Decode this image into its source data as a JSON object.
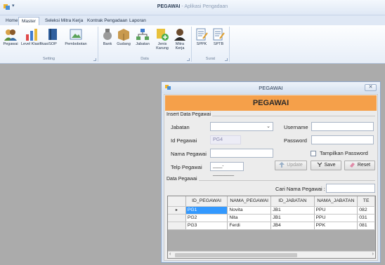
{
  "window": {
    "title_app": "PEGAWAI",
    "title_sep": " - ",
    "title_sub": "Aplikasi Pengadaan"
  },
  "tabs": [
    "Home",
    "Master",
    "Seleksi Mitra Kerja",
    "Kontrak Pengadaan",
    "Laporan"
  ],
  "active_tab": "Master",
  "ribbon": {
    "groups": [
      {
        "label": "Setting",
        "buttons": [
          "Pegawai",
          "Level Klasifikasi",
          "SOP",
          "Pembobotan"
        ]
      },
      {
        "label": "Data",
        "buttons": [
          "Bank",
          "Gudang",
          "Jabatan",
          "Jenis Karung",
          "Mitra Kerja"
        ]
      },
      {
        "label": "Surat",
        "buttons": [
          "SPPK",
          "SPTB"
        ]
      }
    ]
  },
  "dialog": {
    "title": "PEGAWAI",
    "header": "PEGAWAI",
    "close": "✕",
    "insert_section": "Insert Data Pegawai",
    "fields": {
      "jabatan_label": "Jabatan",
      "jabatan_value": "",
      "id_label": "Id Pegawai",
      "id_value": "PG4",
      "nama_label": "Nama Pegawai",
      "nama_value": "",
      "telp_label": "Telp Pegawai",
      "telp_value": "____-_________",
      "username_label": "Username",
      "username_value": "",
      "password_label": "Password",
      "password_value": "",
      "show_password_label": "Tampilkan Password"
    },
    "buttons": {
      "update": "Update",
      "save": "Save",
      "reset": "Reset"
    },
    "data_section": "Data Pegawai",
    "search_label": "Cari Nama Pegawai :",
    "search_value": "",
    "table": {
      "columns": [
        "ID_PEGAWAI",
        "NAMA_PEGAWAI",
        "ID_JABATAN",
        "NAMA_JABATAN",
        "TE"
      ],
      "rows": [
        {
          "marker": "▸",
          "cells": [
            "PG1",
            "Novita",
            "JB1",
            "PPU",
            "082"
          ]
        },
        {
          "marker": "",
          "cells": [
            "PG2",
            "Nita",
            "JB1",
            "PPU",
            "031"
          ]
        },
        {
          "marker": "",
          "cells": [
            "PG3",
            "Ferdi",
            "JB4",
            "PPK",
            "081"
          ]
        }
      ]
    }
  },
  "colors": {
    "header_orange": "#f5a04a",
    "selection_blue": "#3399ff",
    "mdi_gray": "#ababab"
  }
}
